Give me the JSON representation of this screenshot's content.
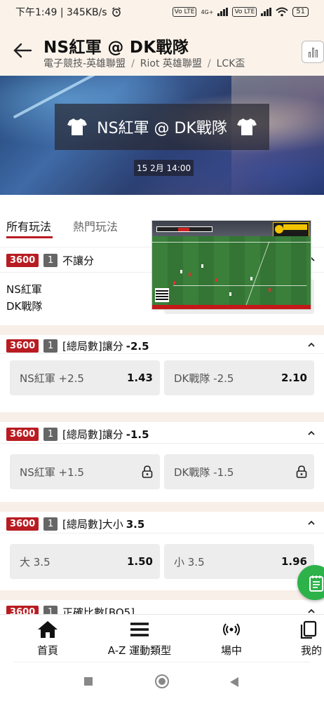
{
  "status_bar": {
    "time_speed": "下午1:49 | 345KB/s",
    "alarm_icon": "alarm-icon",
    "volte1": "Vo LTE",
    "signal": "4G+",
    "volte2": "Vo LTE",
    "battery": "51"
  },
  "header": {
    "title": "NS紅軍 @ DK戰隊",
    "breadcrumb": [
      "電子競技-英雄聯盟",
      "Riot 英雄聯盟",
      "LCK盃"
    ],
    "breadcrumb_sep": "/",
    "stats_icon": "bar-chart-icon"
  },
  "banner": {
    "match": "NS紅軍 @ DK戰隊",
    "date": "15 2月 14:00"
  },
  "tabs": [
    {
      "label": "所有玩法",
      "active": true
    },
    {
      "label": "熱門玩法",
      "active": false
    }
  ],
  "markets": [
    {
      "id": "3600",
      "count": "1",
      "title": "不讓分",
      "handicap": "",
      "teams": [
        "NS紅軍",
        "DK戰隊"
      ]
    },
    {
      "id": "3600",
      "count": "1",
      "title": "[總局數]讓分",
      "handicap": "-2.5",
      "options": [
        {
          "label": "NS紅軍 +2.5",
          "odds": "1.43"
        },
        {
          "label": "DK戰隊 -2.5",
          "odds": "2.10"
        }
      ]
    },
    {
      "id": "3600",
      "count": "1",
      "title": "[總局數]讓分",
      "handicap": "-1.5",
      "options": [
        {
          "label": "NS紅軍 +1.5",
          "odds": "",
          "locked": true
        },
        {
          "label": "DK戰隊 -1.5",
          "odds": "",
          "locked": true
        }
      ]
    },
    {
      "id": "3600",
      "count": "1",
      "title": "[總局數]大小",
      "handicap": "3.5",
      "options": [
        {
          "label": "大 3.5",
          "odds": "1.50"
        },
        {
          "label": "小 3.5",
          "odds": "1.96"
        }
      ]
    },
    {
      "id": "3600",
      "count": "1",
      "title": "正確比數[BO5]",
      "handicap": ""
    }
  ],
  "bottom_nav": [
    {
      "label": "首頁",
      "icon": "home-icon"
    },
    {
      "label": "A-Z 運動類型",
      "icon": "menu-icon"
    },
    {
      "label": "場中",
      "icon": "live-broadcast-icon"
    },
    {
      "label": "我的",
      "icon": "my-bets-icon"
    }
  ],
  "colors": {
    "brand_red": "#b81c22",
    "header_bg": "#fbf3ea",
    "fab_green": "#2db24a"
  }
}
